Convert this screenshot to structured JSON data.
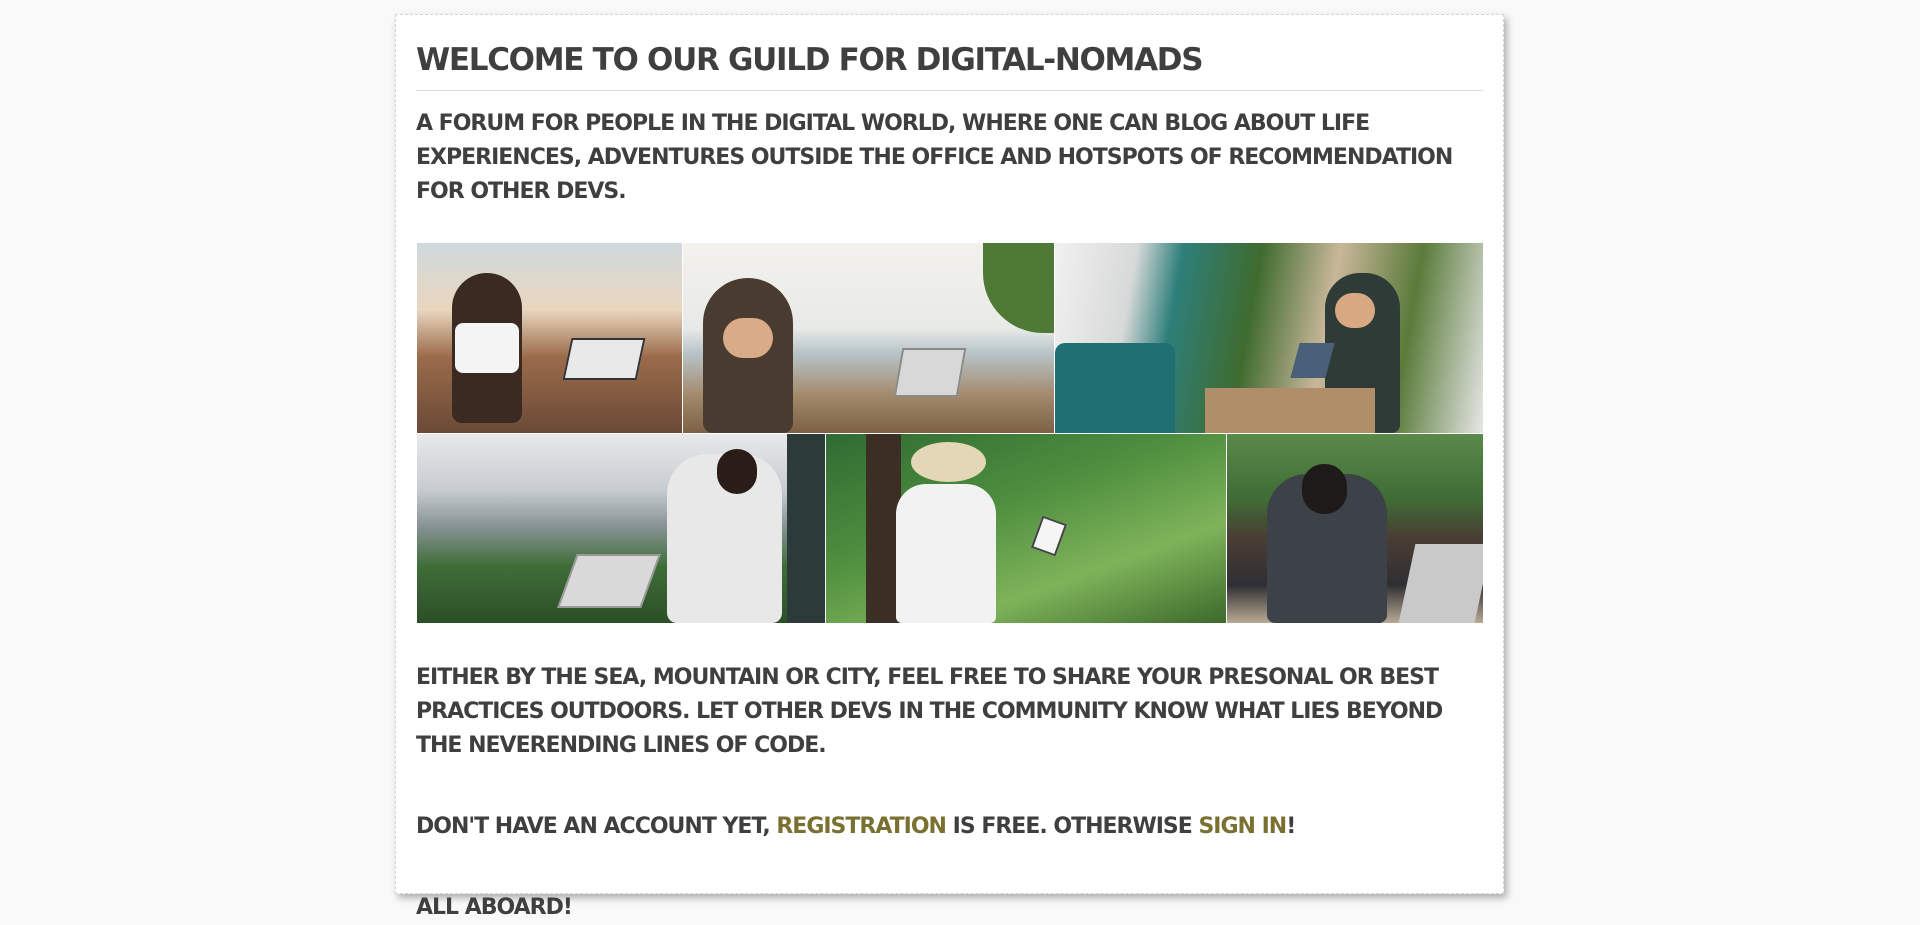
{
  "page": {
    "title": "Welcome to our guild for digital-nomads",
    "lead": "A forum for people in the digital world, where one can blog about life experiences, adventures outside the office and hotspots of recommendation for other devs.",
    "body": "Either by the sea, mountain or city, feel free to share your presonal or best practices outdoors. Let other devs in the community know what lies beyond the neverending lines of code.",
    "cta": {
      "prefix": "Don't have an account yet, ",
      "register_label": "registration",
      "middle": " is free. Otherwise ",
      "signin_label": "sign in",
      "suffix": "!"
    },
    "closing": "All aboard!"
  },
  "gallery": {
    "photos": [
      "woman-with-laptop-on-city-terrace",
      "woman-with-laptop-on-beach-deck",
      "woman-with-laptop-in-camper-van-by-forest-trail",
      "man-with-laptop-on-mountain-overlook",
      "man-in-hat-with-tablet-in-jungle",
      "man-with-laptop-and-drink-by-window"
    ]
  },
  "colors": {
    "background": "#f9f9f9",
    "card": "#ffffff",
    "text": "#3f3f3f",
    "link": "#7a7031"
  }
}
